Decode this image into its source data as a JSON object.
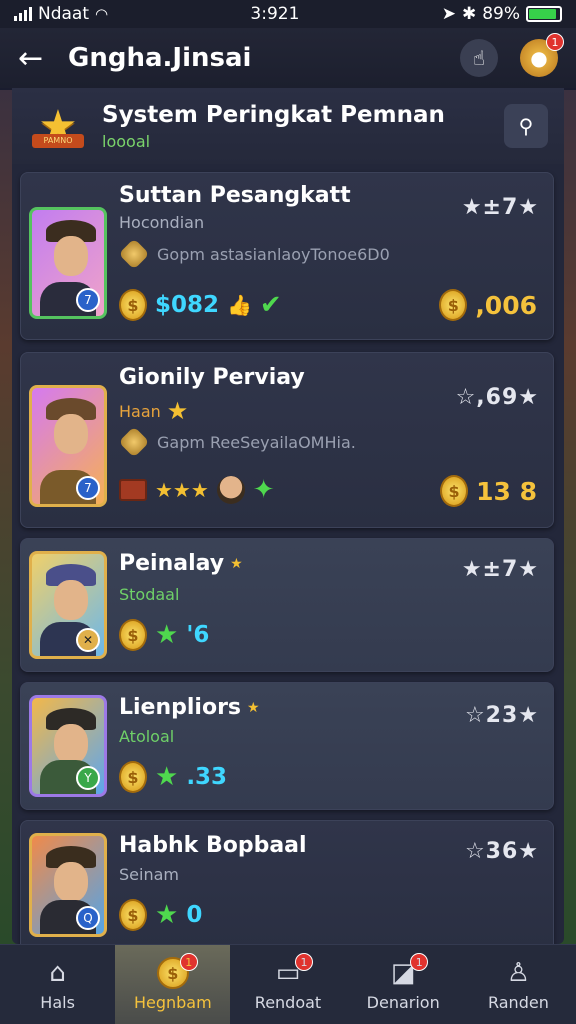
{
  "status_bar": {
    "carrier": "Ndaat",
    "time": "3:921",
    "battery_percent": "89%"
  },
  "header": {
    "title": "Gngha.Jinsai",
    "notification_count": "1"
  },
  "panel": {
    "title": "System Peringkat Pemnan",
    "subtitle": "loooal",
    "logo_ribbon": "PAMNO"
  },
  "cards": [
    {
      "name": "Suttan Pesangkatt",
      "role": "Hocondian",
      "rating": "★±7★",
      "rank_badge": "7",
      "desc": "Gopm astasianlaoyTonoe6D0",
      "value": "$082",
      "right_value": ",006"
    },
    {
      "name": "Gionily Perviay",
      "role": "Haan",
      "rating": "☆,69★",
      "rank_badge": "7",
      "desc": "Gapm ReeSeyailaOMHia.",
      "right_value": "13  8"
    },
    {
      "name": "Peinalay",
      "role": "Stodaal",
      "rating": "★±7★",
      "rank_badge": "✕",
      "value": "'6"
    },
    {
      "name": "Lienpliors",
      "role": "Atoloal",
      "rating": "☆23★",
      "rank_badge": "Y",
      "value": ".33"
    },
    {
      "name": "Habhk Bopbaal",
      "role": "Seinam",
      "rating": "☆36★",
      "rank_badge": "Q",
      "value": "0"
    }
  ],
  "bottom_nav": [
    {
      "label": "Hals",
      "icon": "home-icon"
    },
    {
      "label": "Hegnbam",
      "icon": "coin-icon",
      "badge": "1",
      "active": true
    },
    {
      "label": "Rendoat",
      "icon": "message-icon",
      "badge": "1"
    },
    {
      "label": "Denarion",
      "icon": "chart-icon",
      "badge": "1"
    },
    {
      "label": "Randen",
      "icon": "user-icon"
    }
  ]
}
